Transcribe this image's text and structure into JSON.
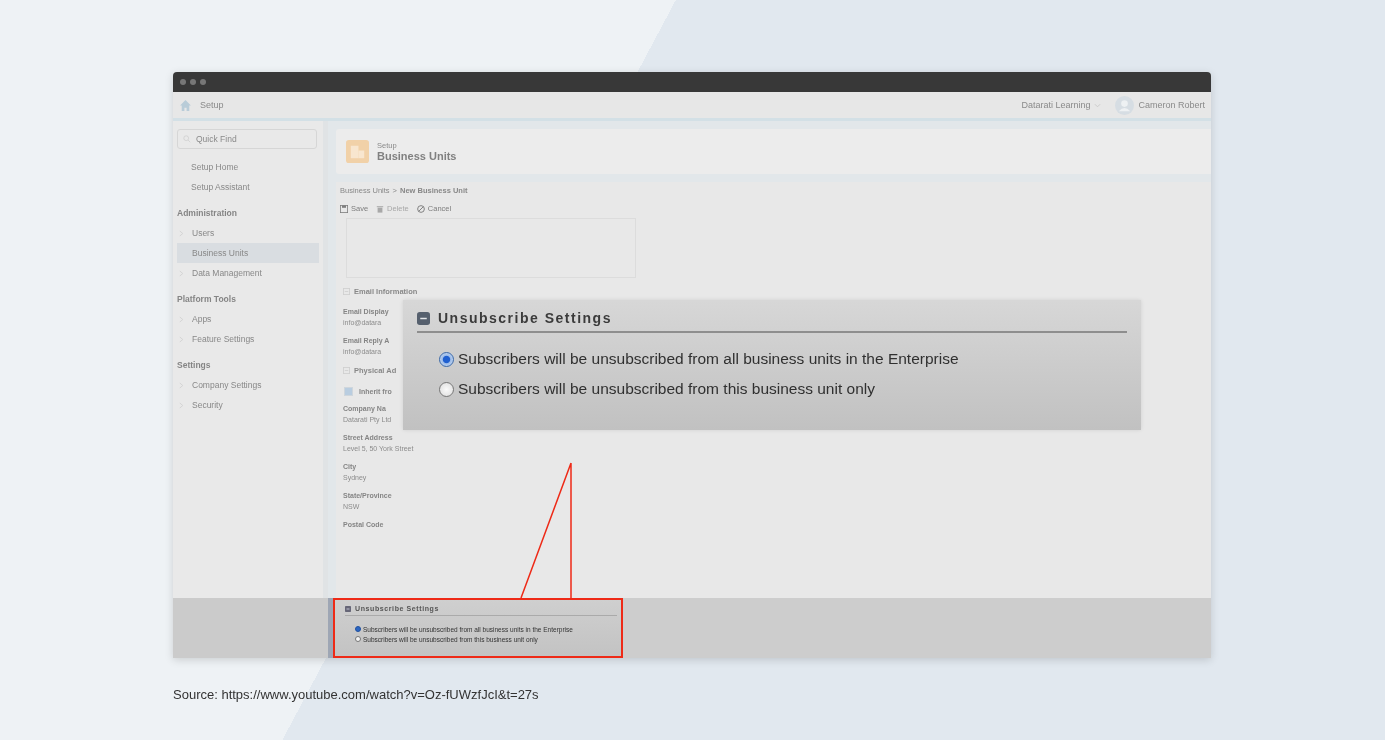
{
  "app_header": {
    "title": "Setup",
    "org_menu": "Datarati Learning",
    "user": "Cameron Robert"
  },
  "sidebar": {
    "search_placeholder": "Quick Find",
    "top_items": [
      {
        "label": "Setup Home"
      },
      {
        "label": "Setup Assistant"
      }
    ],
    "groups": [
      {
        "heading": "Administration",
        "items": [
          {
            "label": "Users",
            "expandable": true,
            "selected": false
          },
          {
            "label": "Business Units",
            "expandable": false,
            "selected": true
          },
          {
            "label": "Data Management",
            "expandable": true,
            "selected": false
          }
        ]
      },
      {
        "heading": "Platform Tools",
        "items": [
          {
            "label": "Apps",
            "expandable": true,
            "selected": false
          },
          {
            "label": "Feature Settings",
            "expandable": true,
            "selected": false
          }
        ]
      },
      {
        "heading": "Settings",
        "items": [
          {
            "label": "Company Settings",
            "expandable": true,
            "selected": false
          },
          {
            "label": "Security",
            "expandable": true,
            "selected": false
          }
        ]
      }
    ]
  },
  "page_header": {
    "eyebrow": "Setup",
    "title": "Business Units"
  },
  "breadcrumb": {
    "parent": "Business Units",
    "separator": ">",
    "current": "New Business Unit"
  },
  "toolbar": [
    {
      "kind": "save",
      "label": "Save",
      "disabled": false
    },
    {
      "kind": "delete",
      "label": "Delete",
      "disabled": true
    },
    {
      "kind": "cancel",
      "label": "Cancel",
      "disabled": false
    }
  ],
  "sections": [
    {
      "title": "Email Information",
      "fields": [
        {
          "kind": "field",
          "label": "Email Display",
          "value": "info@datara"
        },
        {
          "kind": "field",
          "label": "Email Reply A",
          "value": "info@datara"
        }
      ]
    },
    {
      "title": "Physical Ad",
      "fields": [
        {
          "kind": "checkbox",
          "label": "Inherit fro",
          "checked": true
        },
        {
          "kind": "field",
          "label": "Company Na",
          "value": "Datarati Pty Ltd"
        },
        {
          "kind": "field",
          "label": "Street Address",
          "value": "Level 5, 50 York Street"
        },
        {
          "kind": "field",
          "label": "City",
          "value": "Sydney"
        },
        {
          "kind": "field",
          "label": "State/Province",
          "value": "NSW"
        },
        {
          "kind": "field",
          "label": "Postal Code"
        }
      ]
    }
  ],
  "overlay": {
    "title": "Unsubscribe Settings",
    "options": [
      {
        "label": "Subscribers will be unsubscribed from all business units in the Enterprise",
        "selected": true
      },
      {
        "label": "Subscribers will be unsubscribed from this business unit only",
        "selected": false
      }
    ]
  },
  "inset": {
    "title": "Unsubscribe Settings",
    "options": [
      {
        "label": "Subscribers will be unsubscribed from all business units in the Enterprise",
        "selected": true
      },
      {
        "label": "Subscribers will be unsubscribed from this business unit only",
        "selected": false
      }
    ]
  },
  "caption": "Source: https://www.youtube.com/watch?v=Oz-fUWzfJcI&t=27s"
}
